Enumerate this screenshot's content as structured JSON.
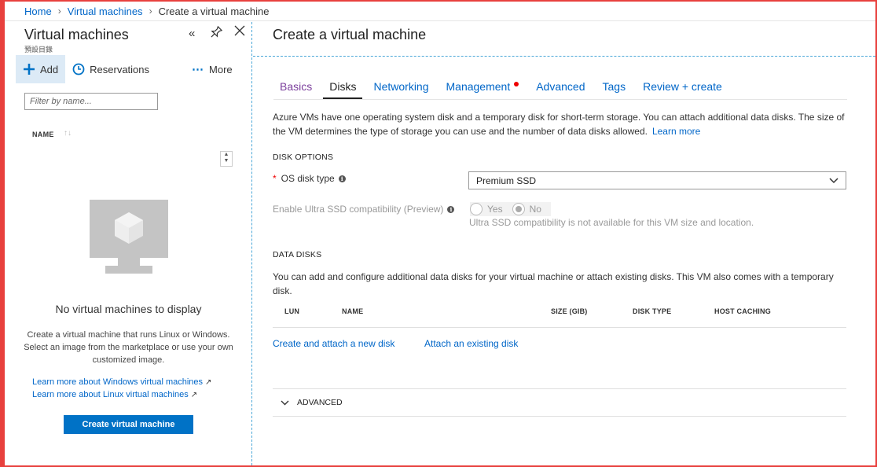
{
  "breadcrumb": {
    "home": "Home",
    "vms": "Virtual machines",
    "current": "Create a virtual machine",
    "sep": ">"
  },
  "left": {
    "title": "Virtual machines",
    "subtitle": "預設目錄",
    "toolbar": {
      "add": "Add",
      "reservations": "Reservations",
      "more": "More"
    },
    "filter_placeholder": "Filter by name...",
    "name_column": "NAME",
    "empty_title": "No virtual machines to display",
    "empty_desc": "Create a virtual machine that runs Linux or Windows. Select an image from the marketplace or use your own customized image.",
    "learn_windows": "Learn more about Windows virtual machines",
    "learn_linux": "Learn more about Linux virtual machines",
    "create_button": "Create virtual machine"
  },
  "right": {
    "title": "Create a virtual machine",
    "tabs": [
      {
        "label": "Basics",
        "state": "visited"
      },
      {
        "label": "Disks",
        "state": "active"
      },
      {
        "label": "Networking",
        "state": ""
      },
      {
        "label": "Management",
        "state": "",
        "dot": true
      },
      {
        "label": "Advanced",
        "state": ""
      },
      {
        "label": "Tags",
        "state": ""
      },
      {
        "label": "Review + create",
        "state": ""
      }
    ],
    "intro": "Azure VMs have one operating system disk and a temporary disk for short-term storage. You can attach additional data disks. The size of the VM determines the type of storage you can use and the number of data disks allowed.",
    "intro_link": "Learn more",
    "disk_options_heading": "DISK OPTIONS",
    "os_disk_label": "OS disk type",
    "os_disk_value": "Premium SSD",
    "ultra_label": "Enable Ultra SSD compatibility (Preview)",
    "ultra_yes": "Yes",
    "ultra_no": "No",
    "ultra_note": "Ultra SSD compatibility is not available for this VM size and location.",
    "data_disks_heading": "DATA DISKS",
    "data_disks_desc": "You can add and configure additional data disks for your virtual machine or attach existing disks. This VM also comes with a temporary disk.",
    "columns": {
      "lun": "LUN",
      "name": "NAME",
      "size": "SIZE (GIB)",
      "type": "DISK TYPE",
      "caching": "HOST CACHING"
    },
    "create_attach": "Create and attach a new disk",
    "attach_existing": "Attach an existing disk",
    "advanced": "ADVANCED"
  },
  "colors": {
    "accent": "#0072c6",
    "link": "#0066c8",
    "border": "#e8403d"
  }
}
